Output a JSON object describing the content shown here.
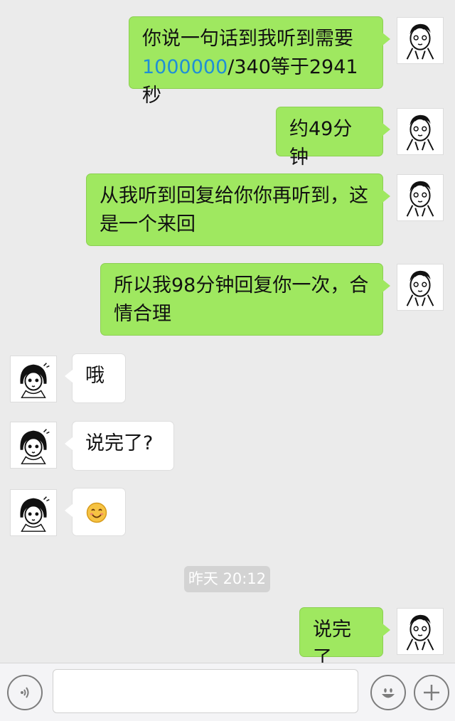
{
  "messages": [
    {
      "side": "out",
      "line1": "你说一句话到我听到需要",
      "link": "1000000",
      "line2_rest": "/340等于2941秒"
    },
    {
      "side": "out",
      "text": "约49分钟"
    },
    {
      "side": "out",
      "line1": "从我听到回复给你你再听到，这",
      "line2": "是一个来回"
    },
    {
      "side": "out",
      "line1": "所以我98分钟回复你一次，合",
      "line2": "情合理"
    },
    {
      "side": "in",
      "text": "哦"
    },
    {
      "side": "in",
      "text": "说完了?"
    },
    {
      "side": "in",
      "emoji": "smile-emoji"
    },
    {
      "side": "out",
      "text": "说完了"
    }
  ],
  "timestamp": "昨天 20:12",
  "input_bar": {
    "voice_icon": "voice-icon",
    "emoji_icon": "emoji-icon",
    "plus_icon": "plus-icon",
    "text_value": ""
  },
  "colors": {
    "outgoing": "#9fe860",
    "incoming": "#ffffff",
    "link": "#1f8fd6",
    "background": "#ebebeb"
  }
}
